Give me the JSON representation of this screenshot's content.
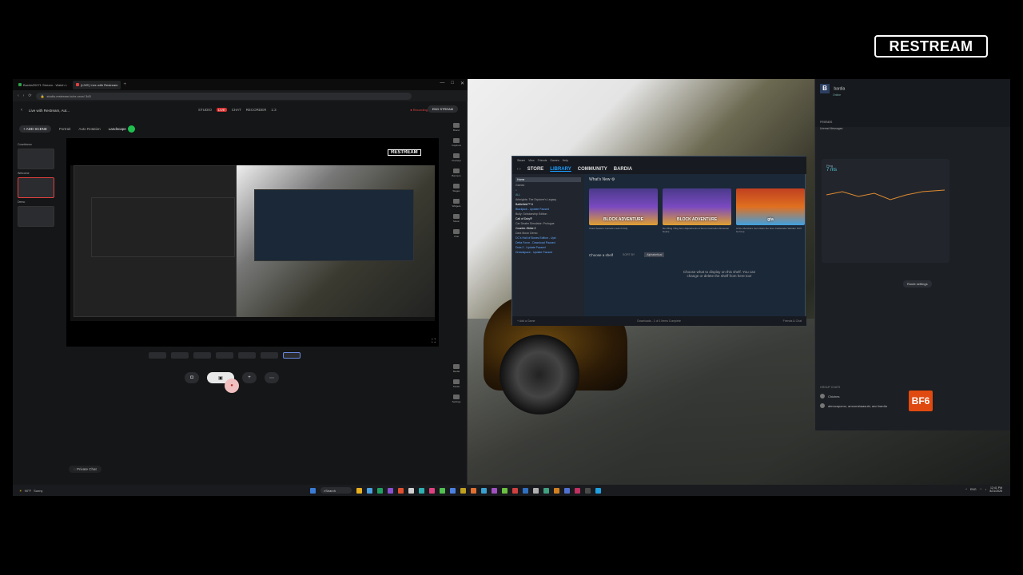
{
  "brand": {
    "logo_text": "RESTREAM"
  },
  "browser": {
    "tabs": [
      {
        "label": "BardiaZ0071 Stream - Watch L",
        "color": "#2ea04a"
      },
      {
        "label": "(LIVE) Live with Restream",
        "color": "#e04040"
      }
    ],
    "add_tab": "+",
    "window_controls": [
      "—",
      "□",
      "✕"
    ],
    "url": "studio.restream.io/xx-xxxx/ 3d3",
    "nav_icons": [
      "‹",
      "›",
      "⟳"
    ]
  },
  "studio": {
    "stream_title": "Live with Restream, Aut...",
    "modes": [
      "STUDIO",
      "LIVE",
      "CHAT",
      "RECORDER",
      "1:3"
    ],
    "live_badge": "LIVE",
    "recording": "● Recording",
    "end_stream": "END STREAM",
    "add_scene": "+ ADD SCENE",
    "layouts": [
      "Portrait",
      "Auto Rotation",
      "Landscape"
    ],
    "scene_labels": [
      "Countdown",
      "Welcome",
      "Demo"
    ],
    "preview_logo": "RESTREAM",
    "right_rail": [
      "Brand",
      "Captions",
      "Overlays",
      "Banners",
      "Stages",
      "Widgets",
      "Music",
      "Chat",
      "Media",
      "Studio",
      "Settings"
    ],
    "private_chat": "Private Chat",
    "controls": {
      "record": "●",
      "camera": "◘",
      "share": "▣",
      "invite": "+",
      "more": "⋯"
    }
  },
  "steam": {
    "menu": [
      "Steam",
      "View",
      "Friends",
      "Games",
      "Help"
    ],
    "nav": [
      "STORE",
      "LIBRARY",
      "COMMUNITY",
      "BARDIA"
    ],
    "active_nav": "LIBRARY",
    "sidebar": {
      "home": "Home",
      "filter": "Games",
      "section": "ALL",
      "games": [
        "Arknights: The Explorer's Legacy",
        "Battlefield™ 6",
        "Blackjack - Update Paused",
        "Bully: Scholarship Edition",
        "Call of Duty®",
        "Car Dealer Simulator: Prologue",
        "Counter-Strike 2",
        "Dark Moon Demo",
        "DC's Hall of Bones Edition - Upd",
        "Delta Force - Download Paused",
        "Dota 2 - Update Paused",
        "Dreadspace - Update Paused"
      ]
    },
    "whats_new": "What's New ⚙",
    "cards": [
      {
        "art": "BLOCK ADVENTURE",
        "caption": "Cloud Season Console Launch FAQ"
      },
      {
        "art": "BLOCK ADVENTURE",
        "caption": "Dev Blog / Bug Item Adjustments & Some Cosmetics Renewal Notice"
      },
      {
        "art": "gta",
        "caption": "GTA+ Members Can Claim the Free Coilwander Warden SUV for Free"
      }
    ],
    "shelf_label": "Choose a shelf",
    "sort_by": "SORT BY",
    "sort_value": "Alphabetical",
    "shelf_msg_1": "Choose what to display on this shelf. You can",
    "shelf_msg_2": "change or delete the shelf from here too!",
    "footer_left": "+ Add a Game",
    "footer_center": "Downloads - 1 of 1 Items Complete",
    "footer_right": "Friends & Chat"
  },
  "friends": {
    "user": "bardia",
    "status": "Online",
    "sections": [
      "FRIENDS",
      "Unread Messages"
    ],
    "ping_label": "Ping",
    "ping_value": "7 ms",
    "route_settings": "Route settings",
    "badge": "BF6",
    "group_chats_header": "GROUP CHATS",
    "group_chats": [
      "Chiches",
      "almocapomo, amoorahaasubi, and bardia"
    ]
  },
  "taskbar": {
    "weather_temp": "90°F",
    "weather_desc": "Sunny",
    "search": "Search",
    "time": "12:41 PM",
    "date": "8/21/2025",
    "tray": [
      "^",
      "ENG"
    ],
    "icon_colors": [
      "#3a7bd5",
      "#e8b020",
      "#4aa0e0",
      "#20a060",
      "#8a50d0",
      "#e05030",
      "#d0d0d0",
      "#30b0b0",
      "#e04080",
      "#50c050",
      "#4a80e0",
      "#c0a020",
      "#e07030",
      "#3aa0d0",
      "#a050c0",
      "#6ac040",
      "#d04040",
      "#3070c0",
      "#b0b0b0",
      "#40a080",
      "#d08020",
      "#5070d0",
      "#c03060",
      "#4a4a4a",
      "#20a0e0"
    ]
  }
}
